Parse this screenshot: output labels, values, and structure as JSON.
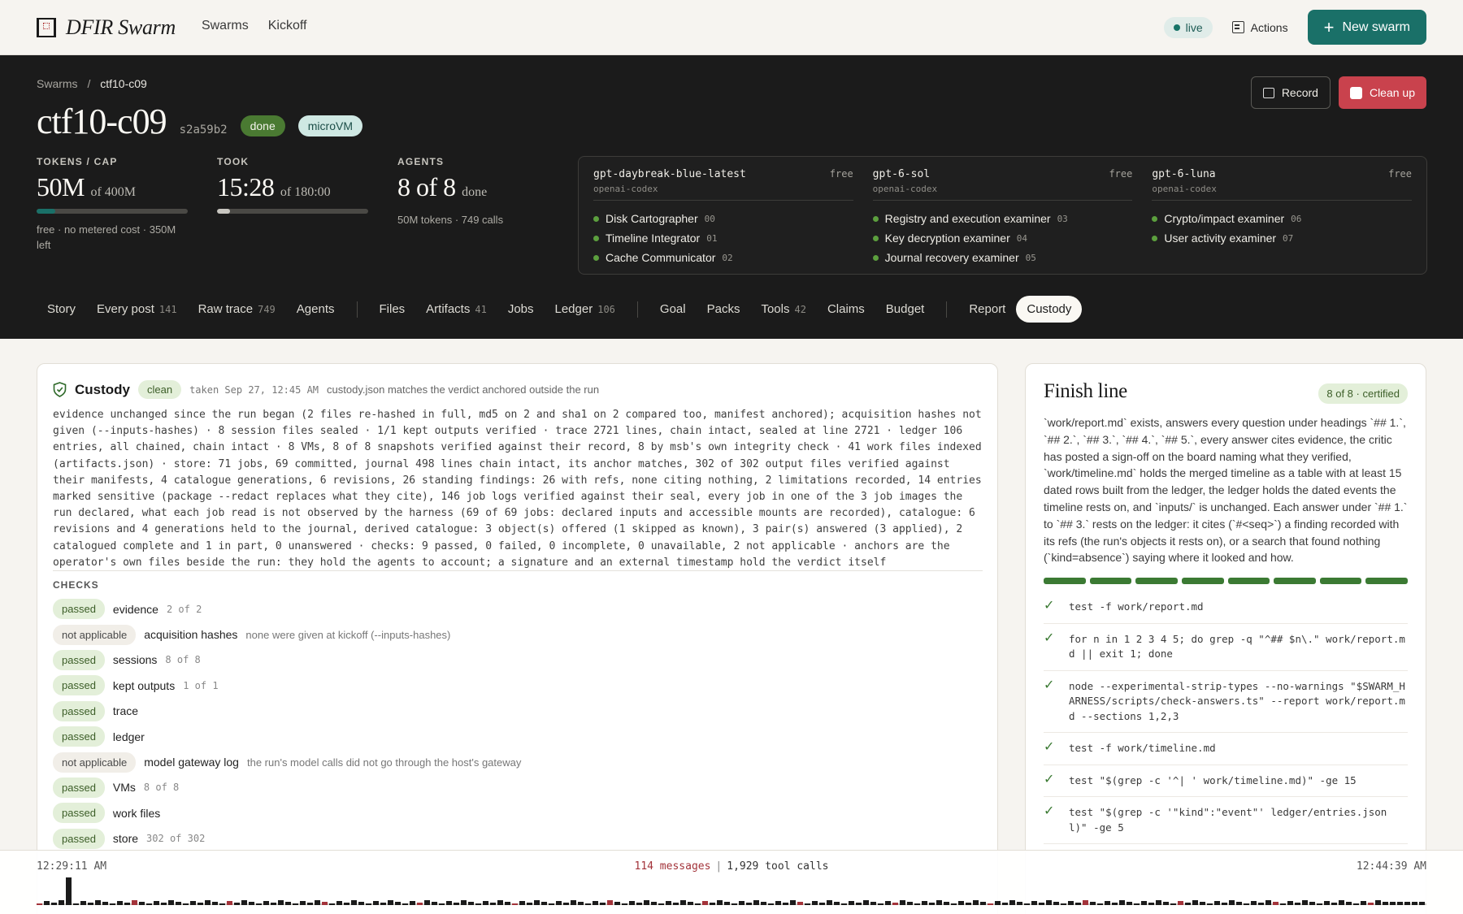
{
  "app": {
    "brand": "DFIR Swarm",
    "nav": [
      "Swarms",
      "Kickoff"
    ],
    "live": "live",
    "actions": "Actions",
    "new_swarm": "New swarm"
  },
  "header": {
    "breadcrumb": [
      "Swarms",
      "ctf10-c09"
    ],
    "breadcrumb_sep": "/",
    "title": "ctf10-c09",
    "hash": "s2a59b2",
    "status": "done",
    "vm": "microVM",
    "record": "Record",
    "cleanup": "Clean up"
  },
  "stats": [
    {
      "label": "TOKENS / CAP",
      "value": "50M",
      "of": "of 400M",
      "sub": "free · no metered cost · 350M left",
      "progress": 0.125,
      "color": "#1a7068"
    },
    {
      "label": "TOOK",
      "value": "15:28",
      "of": "of 180:00",
      "sub": "",
      "progress": 0.086,
      "color": "#c8c6c0"
    },
    {
      "label": "AGENTS",
      "value": "8 of 8",
      "of": "done",
      "sub": "50M tokens · 749 calls"
    }
  ],
  "models": [
    {
      "name": "gpt-daybreak-blue-latest",
      "provider": "openai-codex",
      "tier": "free",
      "agents": [
        {
          "name": "Disk Cartographer",
          "num": "00"
        },
        {
          "name": "Timeline Integrator",
          "num": "01"
        },
        {
          "name": "Cache Communicator",
          "num": "02"
        }
      ]
    },
    {
      "name": "gpt-6-sol",
      "provider": "openai-codex",
      "tier": "free",
      "agents": [
        {
          "name": "Registry and execution examiner",
          "num": "03"
        },
        {
          "name": "Key decryption examiner",
          "num": "04"
        },
        {
          "name": "Journal recovery examiner",
          "num": "05"
        }
      ]
    },
    {
      "name": "gpt-6-luna",
      "provider": "openai-codex",
      "tier": "free",
      "agents": [
        {
          "name": "Crypto/impact examiner",
          "num": "06"
        },
        {
          "name": "User activity examiner",
          "num": "07"
        }
      ]
    }
  ],
  "tabs": [
    {
      "label": "Story",
      "count": ""
    },
    {
      "label": "Every post",
      "count": "141"
    },
    {
      "label": "Raw trace",
      "count": "749"
    },
    {
      "label": "Agents",
      "count": ""
    },
    {
      "label": "Files",
      "count": ""
    },
    {
      "label": "Artifacts",
      "count": "41"
    },
    {
      "label": "Jobs",
      "count": ""
    },
    {
      "label": "Ledger",
      "count": "106"
    },
    {
      "label": "Goal",
      "count": ""
    },
    {
      "label": "Packs",
      "count": ""
    },
    {
      "label": "Tools",
      "count": "42"
    },
    {
      "label": "Claims",
      "count": ""
    },
    {
      "label": "Budget",
      "count": ""
    },
    {
      "label": "Report",
      "count": ""
    },
    {
      "label": "Custody",
      "count": "",
      "active": true
    }
  ],
  "custody": {
    "title": "Custody",
    "status": "clean",
    "taken": "taken Sep 27, 12:45 AM",
    "note": "custody.json matches the verdict anchored outside the run",
    "evidence": "evidence unchanged since the run began (2 files re-hashed in full, md5 on 2 and sha1 on 2 compared too, manifest anchored); acquisition hashes not given (--inputs-hashes) · 8 session files sealed · 1/1 kept outputs verified · trace 2721 lines, chain intact, sealed at line 2721 · ledger 106 entries, all chained, chain intact · 8 VMs, 8 of 8 snapshots verified against their record, 8 by msb's own integrity check · 41 work files indexed (artifacts.json) · store: 71 jobs, 69 committed, journal 498 lines chain intact, its anchor matches, 302 of 302 output files verified against their manifests, 4 catalogue generations, 6 revisions, 26 standing findings: 26 with refs, none citing nothing, 2 limitations recorded, 14 entries marked sensitive (package --redact replaces what they cite), 146 job logs verified against their seal, every job in one of the 3 job images the run declared, what each job read is not observed by the harness (69 of 69 jobs: declared inputs and accessible mounts are recorded), catalogue: 6 revisions and 4 generations held to the journal, derived catalogue: 3 object(s) offered (1 skipped as known), 3 pair(s) answered (3 applied), 2 catalogued complete and 1 in part, 0 unanswered · checks: 9 passed, 0 failed, 0 incomplete, 0 unavailable, 2 not applicable · anchors are the operator's own files beside the run: they hold the agents to account; a signature and an external timestamp hold the verdict itself",
    "checks_label": "CHECKS",
    "checks": [
      {
        "status": "passed",
        "name": "evidence",
        "count": "2 of 2",
        "note": ""
      },
      {
        "status": "not applicable",
        "name": "acquisition hashes",
        "count": "",
        "note": "none were given at kickoff (--inputs-hashes)"
      },
      {
        "status": "passed",
        "name": "sessions",
        "count": "8 of 8",
        "note": ""
      },
      {
        "status": "passed",
        "name": "kept outputs",
        "count": "1 of 1",
        "note": ""
      },
      {
        "status": "passed",
        "name": "trace",
        "count": "",
        "note": ""
      },
      {
        "status": "passed",
        "name": "ledger",
        "count": "",
        "note": ""
      },
      {
        "status": "not applicable",
        "name": "model gateway log",
        "count": "",
        "note": "the run's model calls did not go through the host's gateway"
      },
      {
        "status": "passed",
        "name": "VMs",
        "count": "8 of 8",
        "note": ""
      },
      {
        "status": "passed",
        "name": "work files",
        "count": "",
        "note": ""
      },
      {
        "status": "passed",
        "name": "store",
        "count": "302 of 302",
        "note": ""
      }
    ]
  },
  "finish": {
    "title": "Finish line",
    "badge": "8 of 8 · certified",
    "text": "`work/report.md` exists, answers every question under headings `## 1.`, `## 2.`, `## 3.`, `## 4.`, `## 5.`, every answer cites evidence, the critic has posted a sign-off on the board naming what they verified, `work/timeline.md` holds the merged timeline as a table with at least 15 dated rows built from the ledger, the ledger holds the dated events the timeline rests on, and `inputs/` is unchanged. Each answer under `## 1.` to `## 3.` rests on the ledger: it cites (`#<seq>`) a finding recorded with its refs (the run's objects it rests on), or a search that found nothing (`kind=absence`) saying where it looked and how.",
    "segments": 8,
    "segments_done": 8,
    "commands": [
      "test -f work/report.md",
      "for n in 1 2 3 4 5; do grep -q \"^## $n\\.\" work/report.md || exit 1; done",
      "node --experimental-strip-types --no-warnings \"$SWARM_HARNESS/scripts/check-answers.ts\" --report work/report.md --sections 1,2,3",
      "test -f work/timeline.md",
      "test \"$(grep -c '^| ' work/timeline.md)\" -ge 15",
      "test \"$(grep -c '\"kind\":\"event\"' ledger/entries.json l)\" -ge 5"
    ]
  },
  "timeline": {
    "start": "12:29:11 AM",
    "end": "12:44:39 AM",
    "messages": "114 messages",
    "sep": "|",
    "tool_calls": "1,929 tool calls"
  }
}
